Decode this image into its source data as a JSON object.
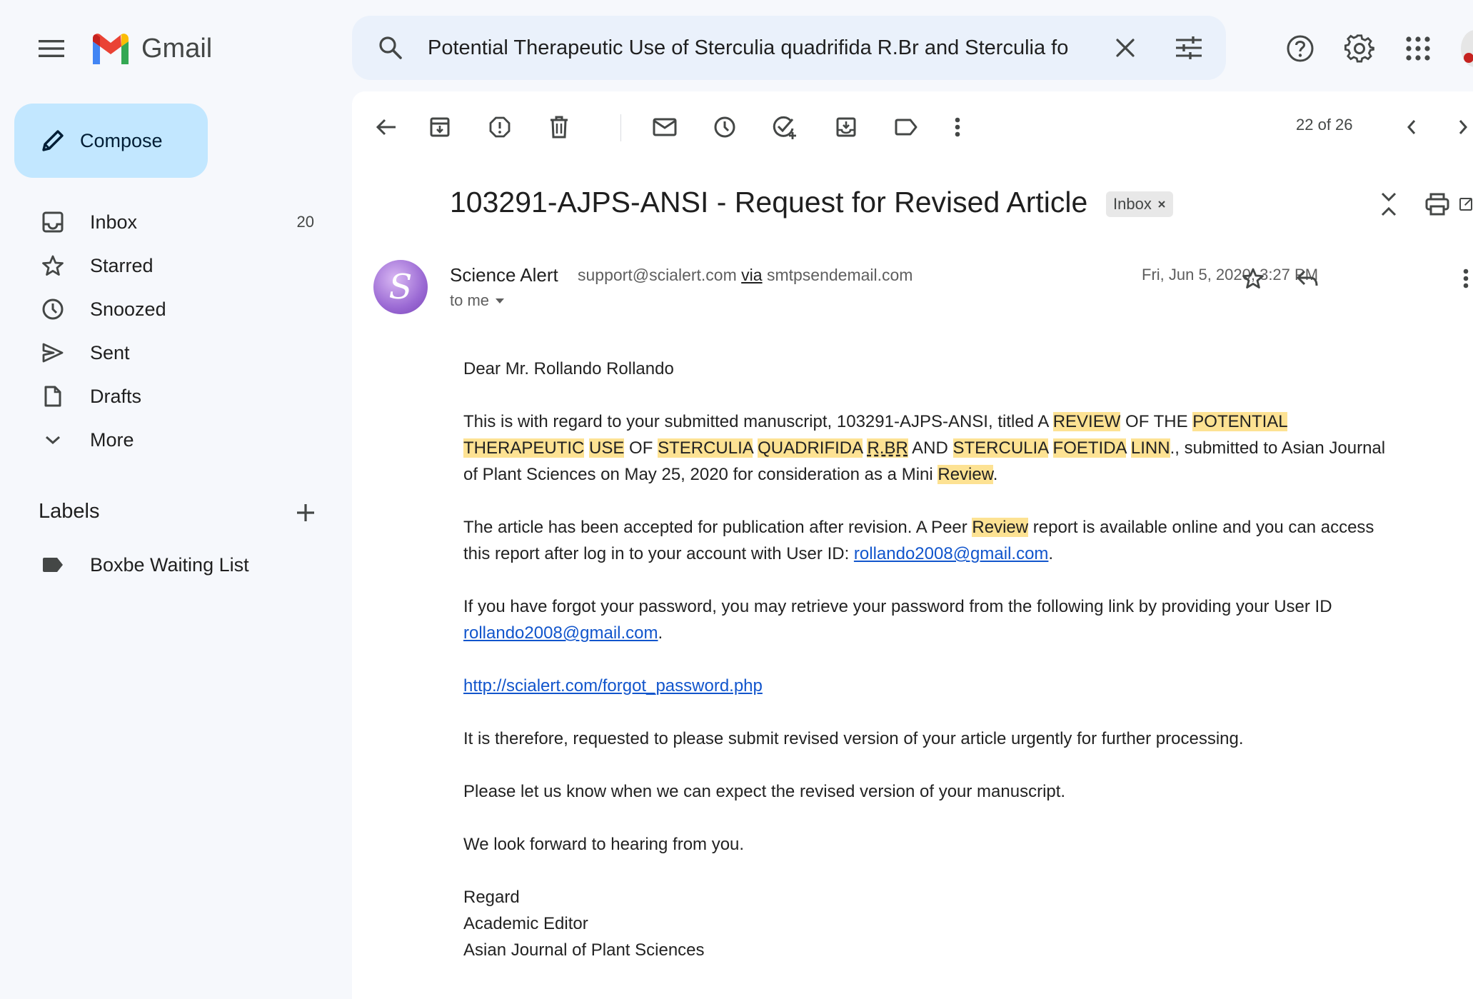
{
  "app": {
    "name": "Gmail",
    "search_query": "Potential Therapeutic Use of Sterculia quadrifida R.Br and Sterculia fo"
  },
  "compose": {
    "label": "Compose"
  },
  "sidebar": {
    "items": [
      {
        "label": "Inbox",
        "count": "20",
        "icon": "inbox-icon"
      },
      {
        "label": "Starred",
        "count": "",
        "icon": "star-icon"
      },
      {
        "label": "Snoozed",
        "count": "",
        "icon": "clock-icon"
      },
      {
        "label": "Sent",
        "count": "",
        "icon": "send-icon"
      },
      {
        "label": "Drafts",
        "count": "",
        "icon": "draft-icon"
      },
      {
        "label": "More",
        "count": "",
        "icon": "chevron-down-icon"
      }
    ],
    "labels_title": "Labels",
    "labels": [
      {
        "label": "Boxbe Waiting List",
        "icon": "label-icon"
      }
    ]
  },
  "toolbar": {
    "counter": "22 of 26"
  },
  "email": {
    "subject": "103291-AJPS-ANSI - Request for Revised Article",
    "badge": "Inbox",
    "sender_name": "Science Alert",
    "sender_email": "support@scialert.com",
    "via_word": "via",
    "via_domain": "smtpsendemail.com",
    "to": "to me",
    "date": "Fri, Jun 5, 2020, 3:27 PM",
    "avatar_letter": "S",
    "body": {
      "greeting": "Dear Mr. Rollando Rollando",
      "p1_a": "This is with regard to your submitted manuscript, 103291-AJPS-ANSI, titled A ",
      "p1_review": "REVIEW",
      "p1_b": " OF THE ",
      "p1_potential": "POTENTIAL",
      "p1_therapeutic": "THERAPEUTIC",
      "p1_use": "USE",
      "p1_c": " OF ",
      "p1_sterculia1": "STERCULIA",
      "p1_quadrifida": "QUADRIFIDA",
      "p1_rbr": "R.BR",
      "p1_d": " AND ",
      "p1_sterculia2": "STERCULIA",
      "p1_foetida": "FOETIDA",
      "p1_linn": "LINN",
      "p1_e": "., submitted to Asian Journal of Plant Sciences on May 25, 2020 for consideration as a Mini ",
      "p1_review2": "Review",
      "p1_f": ".",
      "p2_a": "The article has been accepted for publication after revision. A Peer ",
      "p2_review": "Review",
      "p2_b": " report is available online and you can access this report after log in to your account with User ID: ",
      "p2_email": "rollando2008@gmail.com",
      "p2_c": ".",
      "p3_a": "If you have forgot your password, you may retrieve your password from the following link by providing your User ID ",
      "p3_email": "rollando2008@gmail.com",
      "p3_b": ".",
      "link": "http://scialert.com/forgot_password.php",
      "p4": "It is therefore, requested to please submit revised version of your article urgently for further processing.",
      "p5": "Please let us know when we can expect the revised version of your manuscript.",
      "p6": "We look forward to hearing from you.",
      "sig1": "Regard",
      "sig2": "Academic Editor",
      "sig3": "Asian Journal of Plant Sciences"
    }
  },
  "colors": {
    "compose_bg": "#c2e7ff",
    "search_bg": "#eaf1fb",
    "highlight": "#fde293",
    "link": "#1155cc"
  }
}
